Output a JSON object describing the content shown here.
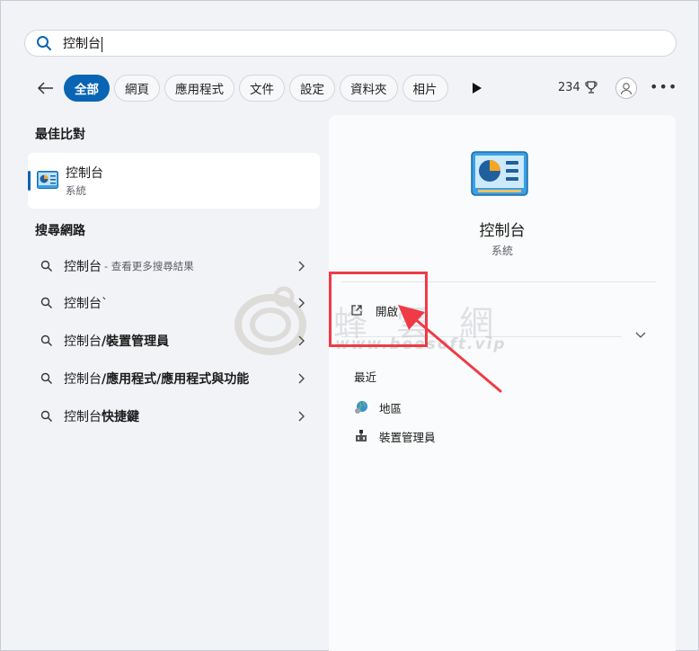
{
  "search": {
    "value": "控制台"
  },
  "filters": {
    "tabs": [
      "全部",
      "網頁",
      "應用程式",
      "文件",
      "設定",
      "資料夾",
      "相片"
    ],
    "points": "234"
  },
  "best_match": {
    "section_title": "最佳比對",
    "name": "控制台",
    "type": "系統"
  },
  "web_search": {
    "section_title": "搜尋網路",
    "items": [
      {
        "prefix": "控制台",
        "bold": "",
        "hint": "- 查看更多搜尋結果"
      },
      {
        "prefix": "控制台`",
        "bold": "",
        "hint": ""
      },
      {
        "prefix": "控制台",
        "bold": "/裝置管理員",
        "hint": ""
      },
      {
        "prefix": "控制台",
        "bold": "/應用程式/應用程式與功能",
        "hint": ""
      },
      {
        "prefix": "控制台",
        "bold": "快捷鍵",
        "hint": ""
      }
    ]
  },
  "detail": {
    "title": "控制台",
    "subtitle": "系統",
    "open_label": "開啟",
    "recent_title": "最近",
    "recent": [
      {
        "label": "地區",
        "icon": "globe-icon"
      },
      {
        "label": "裝置管理員",
        "icon": "device-manager-icon"
      }
    ]
  },
  "watermark": {
    "brand": "蜂 雲 網",
    "url": "www.beesoft.vip"
  },
  "colors": {
    "accent": "#0a64b4",
    "annotation": "#ef3b46"
  }
}
